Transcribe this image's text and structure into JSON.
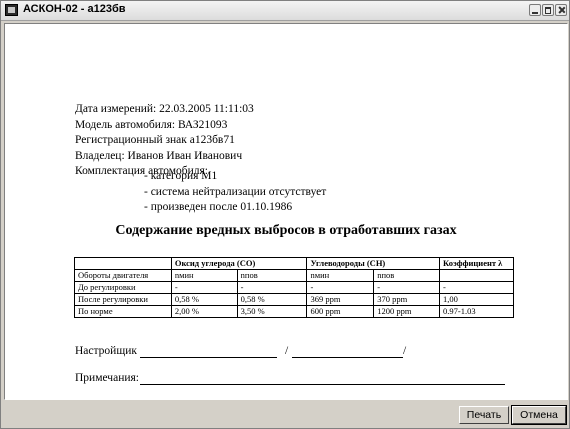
{
  "window": {
    "title": "АСКОН-02 - а123бв"
  },
  "document": {
    "info_lines": [
      "Дата измерений: 22.03.2005 11:11:03",
      "Модель автомобиля: ВАЗ21093",
      "Регистрационный знак а123бв71",
      "Владелец: Иванов Иван Иванович",
      "Комплектация автомобиля:"
    ],
    "equipment": [
      "- категория М1",
      "- система нейтрализации отсутствует",
      "- произведен после 01.10.1986"
    ],
    "report_title": "Содержание вредных выбросов в отработавших газах",
    "table": {
      "group_headers": [
        "Оксид углерода (СО)",
        "Углеводороды (СН)",
        "Коэффициент λ"
      ],
      "subheader": [
        "Обороты двигателя",
        "nмин",
        "nпов",
        "nмин",
        "nпов",
        ""
      ],
      "rows": [
        [
          "До регулировки",
          "-",
          "-",
          "-",
          "-",
          "-"
        ],
        [
          "После регулировки",
          "0,58 %",
          "0,58 %",
          "369 ppm",
          "370 ppm",
          "1,00"
        ],
        [
          "По норме",
          "2,00 %",
          "3,50 %",
          "600 ppm",
          "1200 ppm",
          "0.97-1.03"
        ]
      ]
    },
    "adjuster_label": "Настройщик",
    "notes_label": "Примечания:"
  },
  "buttons": {
    "print": "Печать",
    "cancel": "Отмена"
  }
}
